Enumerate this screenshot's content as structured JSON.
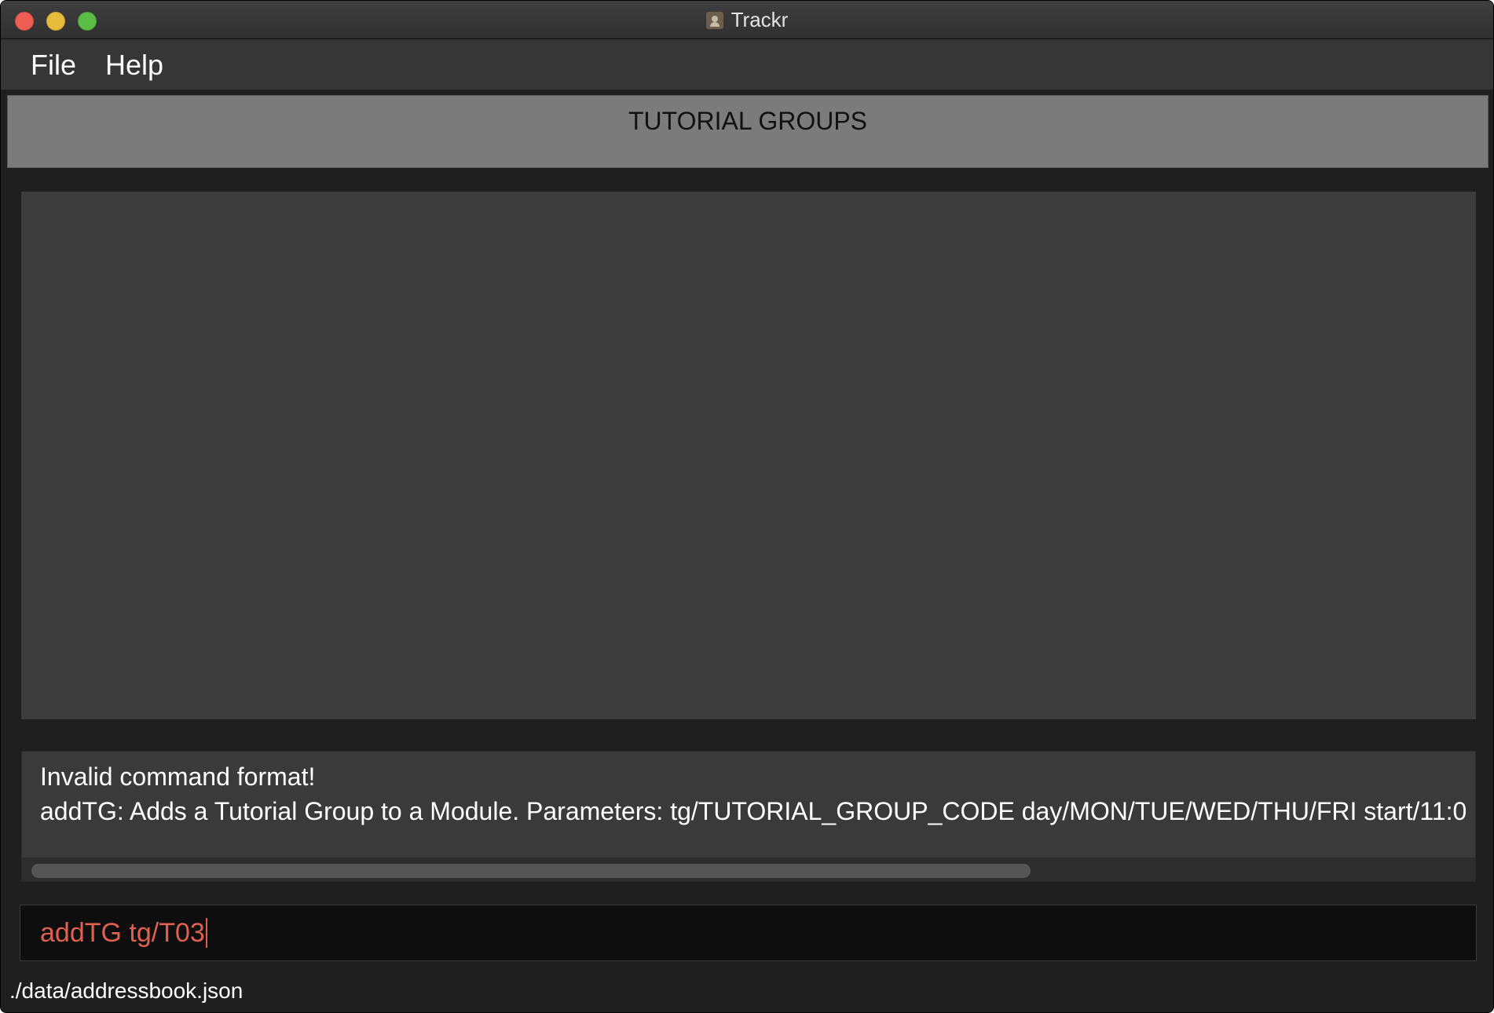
{
  "window": {
    "title": "Trackr"
  },
  "menu": {
    "items": [
      {
        "label": "File"
      },
      {
        "label": "Help"
      }
    ]
  },
  "header": {
    "title": "TUTORIAL GROUPS"
  },
  "result": {
    "lines": [
      "Invalid command format!",
      "addTG: Adds a Tutorial Group to a Module. Parameters: tg/TUTORIAL_GROUP_CODE day/MON/TUE/WED/THU/FRI start/11:0"
    ]
  },
  "command": {
    "value": "addTG tg/T03",
    "text_color": "#e06050"
  },
  "status": {
    "file_path": "./data/addressbook.json"
  },
  "colors": {
    "close": "#ed5e55",
    "minimize": "#e7bc3d",
    "maximize": "#5bbc46",
    "header_bg": "#7b7b7b",
    "panel_bg": "#3d3d3d"
  },
  "icons": {
    "app": "person-icon",
    "window_controls": [
      "close-icon",
      "minimize-icon",
      "maximize-icon"
    ]
  }
}
